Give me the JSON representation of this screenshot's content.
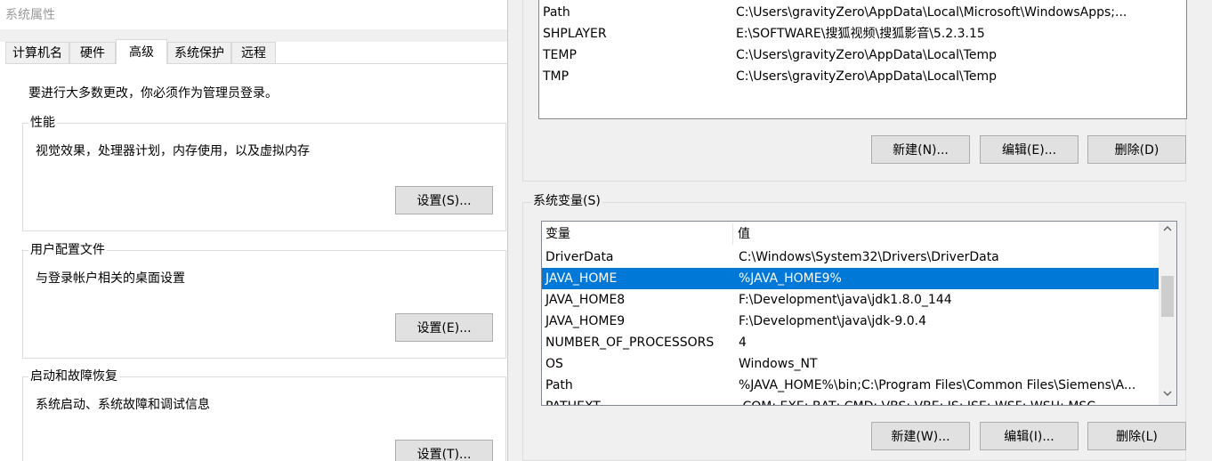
{
  "left_window": {
    "title": "系统属性",
    "tabs": [
      {
        "label": "计算机名",
        "active": false
      },
      {
        "label": "硬件",
        "active": false
      },
      {
        "label": "高级",
        "active": true
      },
      {
        "label": "系统保护",
        "active": false
      },
      {
        "label": "远程",
        "active": false
      }
    ],
    "admin_note": "要进行大多数更改，你必须作为管理员登录。",
    "performance": {
      "title": "性能",
      "desc": "视觉效果，处理器计划，内存使用，以及虚拟内存",
      "button": "设置(S)..."
    },
    "user_profiles": {
      "title": "用户配置文件",
      "desc": "与登录帐户相关的桌面设置",
      "button": "设置(E)..."
    },
    "startup_recovery": {
      "title": "启动和故障恢复",
      "desc": "系统启动、系统故障和调试信息",
      "button": "设置(T)..."
    }
  },
  "user_vars": {
    "rows": [
      {
        "name": "Path",
        "value": "C:\\Users\\gravityZero\\AppData\\Local\\Microsoft\\WindowsApps;..."
      },
      {
        "name": "SHPLAYER",
        "value": "E:\\SOFTWARE\\搜狐视频\\搜狐影音\\5.2.3.15"
      },
      {
        "name": "TEMP",
        "value": "C:\\Users\\gravityZero\\AppData\\Local\\Temp"
      },
      {
        "name": "TMP",
        "value": "C:\\Users\\gravityZero\\AppData\\Local\\Temp"
      }
    ],
    "buttons": {
      "new": "新建(N)...",
      "edit": "编辑(E)...",
      "delete": "删除(D)"
    }
  },
  "system_vars": {
    "title": "系统变量(S)",
    "col_var": "变量",
    "col_val": "值",
    "selected_index": 1,
    "rows": [
      {
        "name": "DriverData",
        "value": "C:\\Windows\\System32\\Drivers\\DriverData"
      },
      {
        "name": "JAVA_HOME",
        "value": "%JAVA_HOME9%"
      },
      {
        "name": "JAVA_HOME8",
        "value": "F:\\Development\\java\\jdk1.8.0_144"
      },
      {
        "name": "JAVA_HOME9",
        "value": "F:\\Development\\java\\jdk-9.0.4"
      },
      {
        "name": "NUMBER_OF_PROCESSORS",
        "value": "4"
      },
      {
        "name": "OS",
        "value": "Windows_NT"
      },
      {
        "name": "Path",
        "value": "%JAVA_HOME%\\bin;C:\\Program Files\\Common Files\\Siemens\\A..."
      },
      {
        "name": "PATHEXT",
        "value": ".COM;.EXE;.BAT;.CMD;.VBS;.VBE;.JS;.JSE;.WSF;.WSH;.MSC"
      }
    ],
    "buttons": {
      "new": "新建(W)...",
      "edit": "编辑(I)...",
      "delete": "删除(L)"
    },
    "scroll_up_icon": "chevron-up-icon",
    "scroll_down_icon": "chevron-down-icon"
  },
  "colors": {
    "selection": "#0078d7",
    "button_bg": "#e1e1e1",
    "dialog_bg": "#f0f0f0"
  }
}
